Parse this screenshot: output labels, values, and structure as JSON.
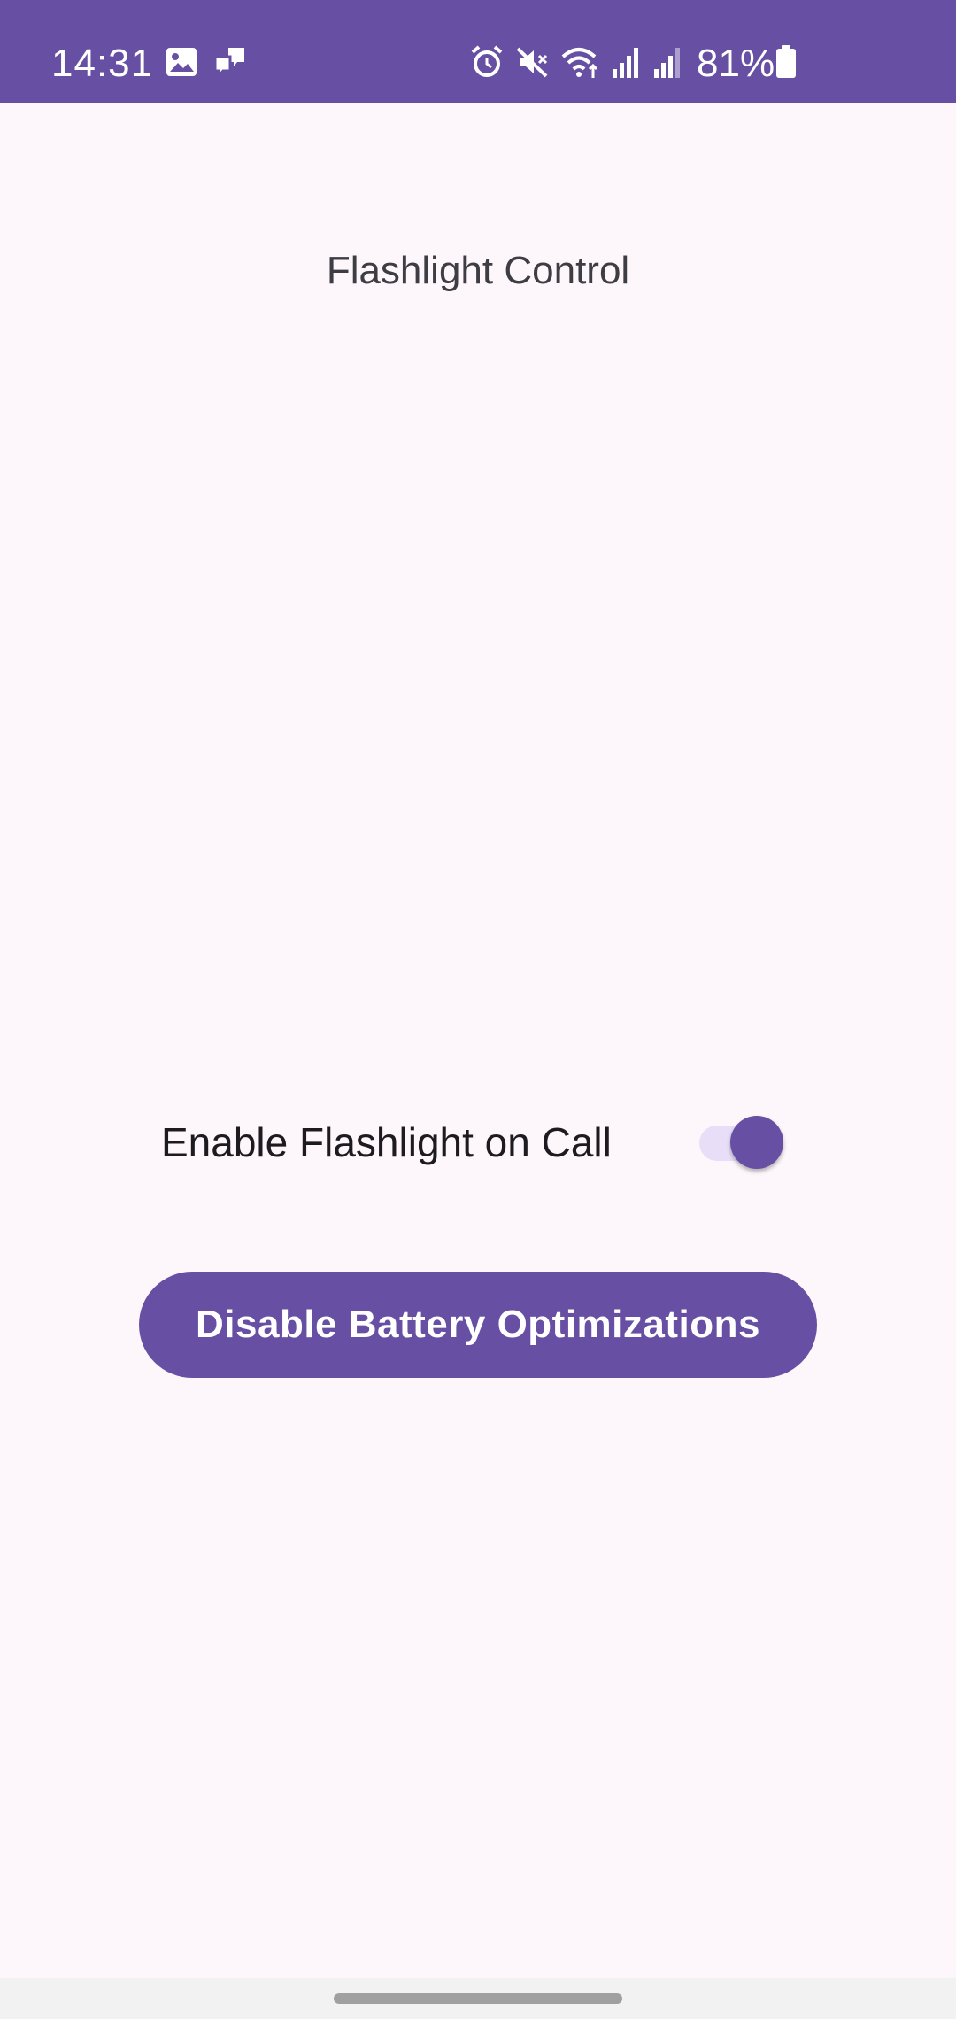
{
  "status_bar": {
    "time": "14:31",
    "battery_percent": "81%",
    "background_color": "#6750A4",
    "left_icons": [
      "gallery-icon",
      "chat-bubbles-icon"
    ],
    "right_icons": [
      "alarm-icon",
      "mute-icon",
      "wifi-icon",
      "signal-icon",
      "signal-icon",
      "battery-icon"
    ]
  },
  "screen": {
    "title": "Flashlight Control",
    "toggle": {
      "label": "Enable Flashlight on Call",
      "checked": true
    },
    "button": {
      "label": "Disable Battery Optimizations"
    }
  },
  "colors": {
    "primary": "#6750A4",
    "background": "#FDF7FC",
    "switch_track": "#E8DEF8",
    "text": "#1D1B20"
  }
}
